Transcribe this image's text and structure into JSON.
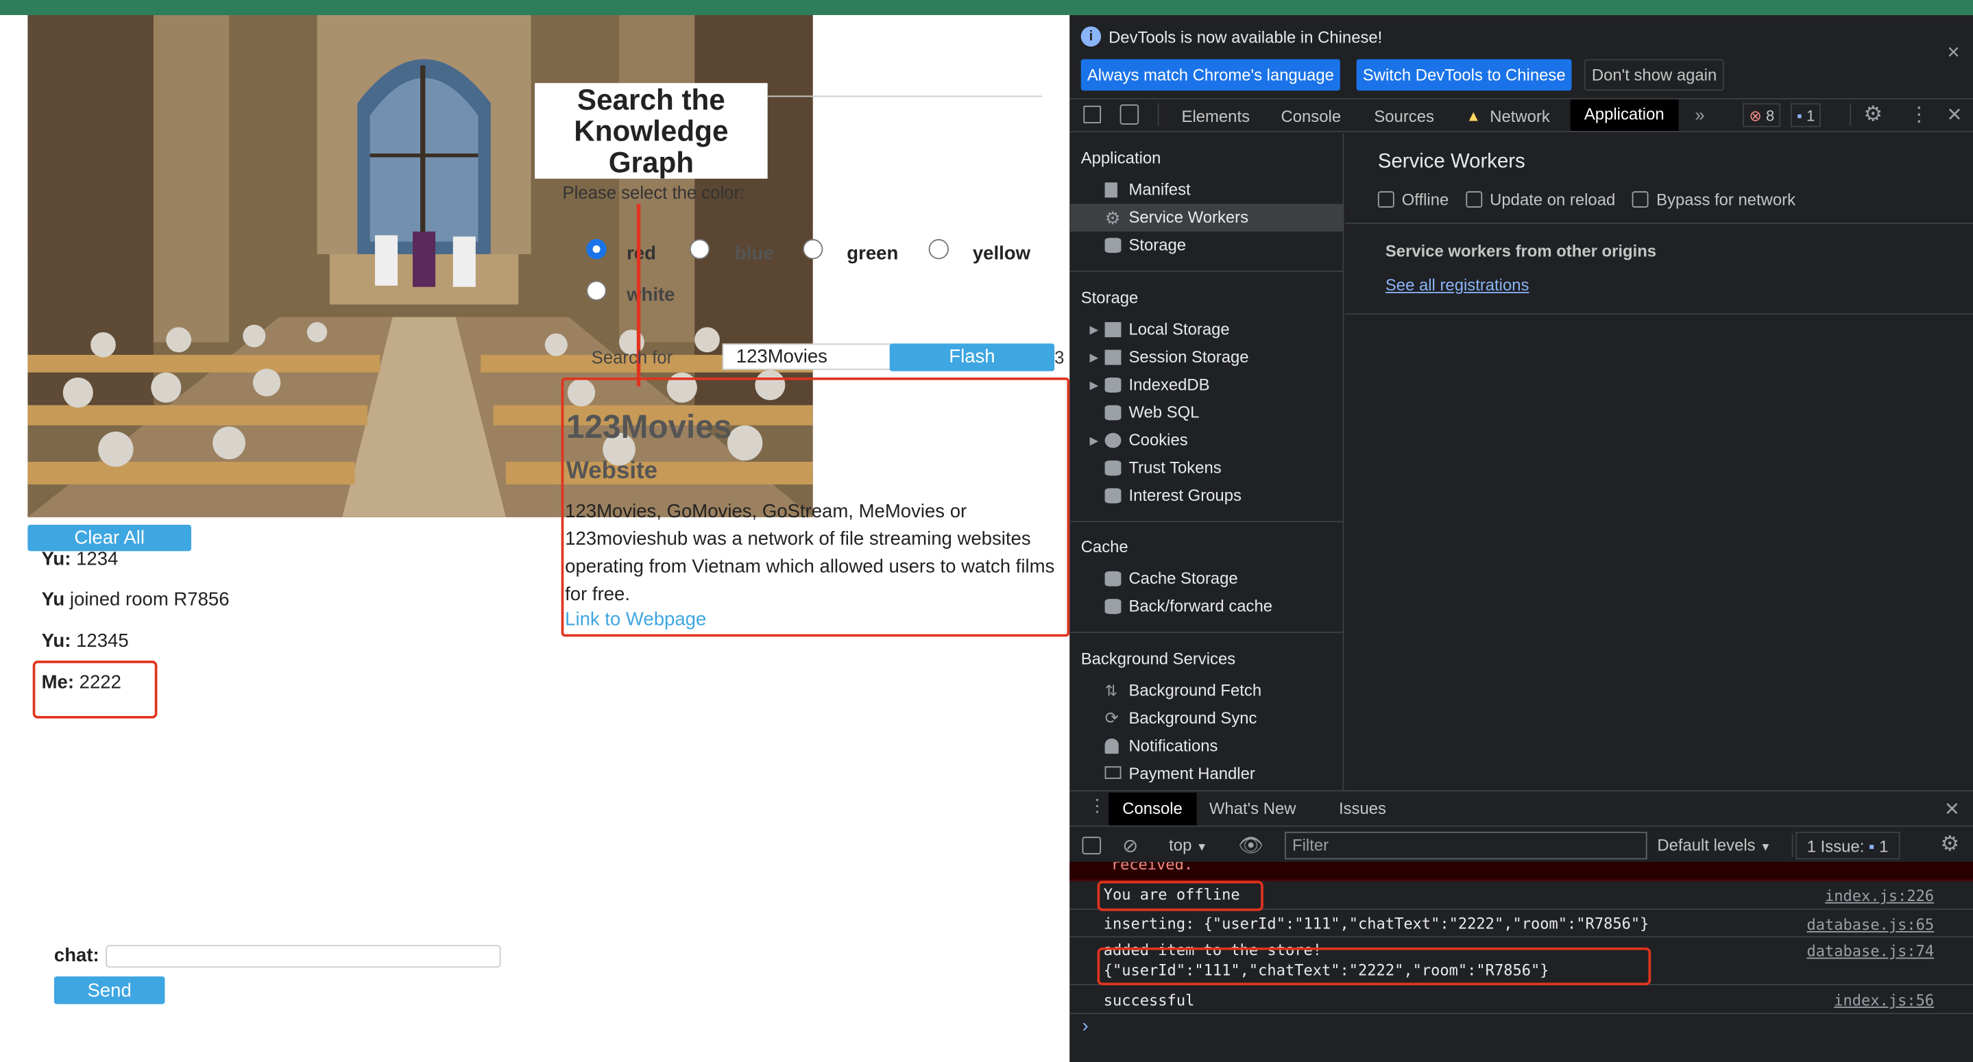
{
  "page": {
    "kg_title_l1": "Search the",
    "kg_title_l2": "Knowledge",
    "kg_title_l3": "Graph",
    "color_prompt": "Please select the color:",
    "colors": [
      "red",
      "blue",
      "green",
      "yellow",
      "white"
    ],
    "search_label": "Search for",
    "search_value": "123Movies",
    "flash_label": "Flash",
    "result_title": "123Movies",
    "result_subtitle": "Website",
    "result_desc": "123Movies, GoMovies, GoStream, MeMovies or 123movieshub was a network of file streaming websites operating from Vietnam which allowed users to watch films for free.",
    "result_link": "Link to Webpage",
    "clear_label": "Clear All",
    "messages": [
      {
        "who": "Yu:",
        "text": " 1234"
      },
      {
        "who": "Yu",
        "text": " joined room R7856"
      },
      {
        "who": "Yu:",
        "text": " 12345"
      },
      {
        "who": "Me:",
        "text": " 2222"
      }
    ],
    "chat_label": "chat:",
    "send_label": "Send"
  },
  "devtools": {
    "banner_text": "DevTools is now available in Chinese!",
    "banner_btn1": "Always match Chrome's language",
    "banner_btn2": "Switch DevTools to Chinese",
    "banner_btn3": "Don't show again",
    "tabs": [
      "Elements",
      "Console",
      "Sources",
      "Network",
      "Application"
    ],
    "error_count": "8",
    "msg_count": "1",
    "sidebar": {
      "application_header": "Application",
      "application_items": [
        "Manifest",
        "Service Workers",
        "Storage"
      ],
      "storage_header": "Storage",
      "storage_items": [
        "Local Storage",
        "Session Storage",
        "IndexedDB",
        "Web SQL",
        "Cookies",
        "Trust Tokens",
        "Interest Groups"
      ],
      "cache_header": "Cache",
      "cache_items": [
        "Cache Storage",
        "Back/forward cache"
      ],
      "bg_header": "Background Services",
      "bg_items": [
        "Background Fetch",
        "Background Sync",
        "Notifications",
        "Payment Handler"
      ]
    },
    "sw": {
      "title": "Service Workers",
      "offline": "Offline",
      "update": "Update on reload",
      "bypass": "Bypass for network",
      "other_origins": "Service workers from other origins",
      "see_all": "See all registrations"
    },
    "drawer": {
      "tabs": [
        "Console",
        "What's New",
        "Issues"
      ],
      "context": "top",
      "filter_placeholder": "Filter",
      "levels": "Default levels",
      "issues": "1 Issue:",
      "issues_count": "1"
    },
    "console": [
      {
        "text": "received.",
        "src": ""
      },
      {
        "text": "You are offline",
        "src": "index.js:226"
      },
      {
        "text": "inserting: {\"userId\":\"111\",\"chatText\":\"2222\",\"room\":\"R7856\"}",
        "src": "database.js:65"
      },
      {
        "text": "added item to the store!",
        "src": "database.js:74"
      },
      {
        "text": "{\"userId\":\"111\",\"chatText\":\"2222\",\"room\":\"R7856\"}",
        "src": ""
      },
      {
        "text": "successful",
        "src": "index.js:56"
      }
    ],
    "prompt": "›"
  }
}
